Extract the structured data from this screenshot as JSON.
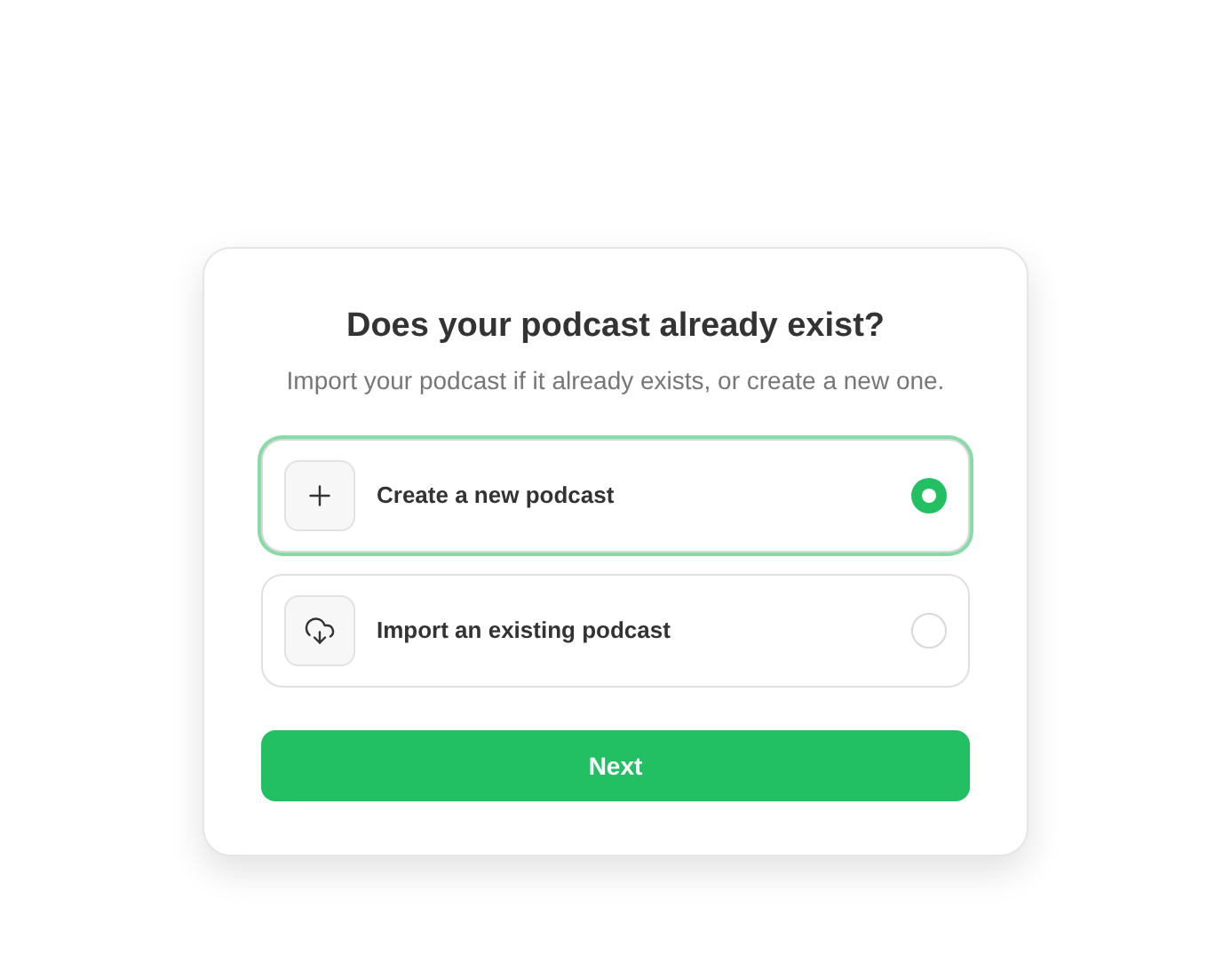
{
  "title": "Does your podcast already exist?",
  "subtitle": "Import your podcast if it already exists, or create a new one.",
  "options": [
    {
      "kind": "create",
      "label": "Create a new podcast",
      "selected": true
    },
    {
      "kind": "import",
      "label": "Import an existing podcast",
      "selected": false
    }
  ],
  "button": "Next"
}
